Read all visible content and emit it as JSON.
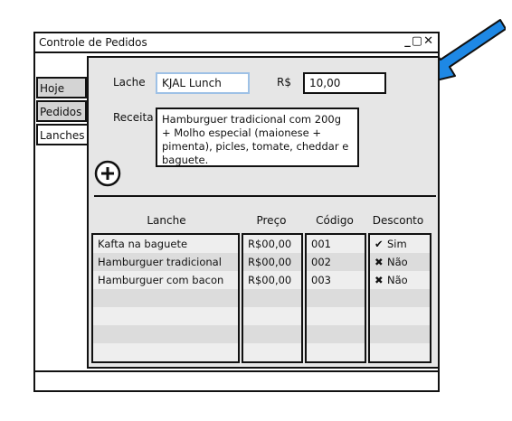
{
  "window": {
    "title": "Controle de Pedidos",
    "controls": [
      "_",
      "▢",
      "✕"
    ]
  },
  "tabs": [
    {
      "label": "Hoje",
      "active": false
    },
    {
      "label": "Pedidos",
      "active": false
    },
    {
      "label": "Lanches",
      "active": true
    }
  ],
  "form": {
    "lanche_label": "Lache",
    "lanche_value": "KJAL Lunch",
    "price_label": "R$",
    "price_value": "10,00",
    "receita_label": "Receita",
    "receita_value": "Hamburguer tradicional com 200g + Molho especial (maionese + pimenta), picles, tomate, cheddar e baguete."
  },
  "add_icon": "plus-circle-icon",
  "table": {
    "headers": {
      "lanche": "Lanche",
      "preco": "Preço",
      "codigo": "Código",
      "desconto": "Desconto"
    },
    "rows": [
      {
        "lanche": "Kafta na baguete",
        "preco": "R$00,00",
        "codigo": "001",
        "desconto": "Sim",
        "mark": "✔"
      },
      {
        "lanche": "Hamburguer tradicional",
        "preco": "R$00,00",
        "codigo": "002",
        "desconto": "Não",
        "mark": "✖"
      },
      {
        "lanche": "Hamburguer com bacon",
        "preco": "R$00,00",
        "codigo": "003",
        "desconto": "Não",
        "mark": "✖"
      }
    ],
    "empty_rows": 4
  },
  "colors": {
    "arrow": "#1e88e5",
    "panel": "#e6e6e6",
    "tab_inactive": "#d4d4d4",
    "focus_border": "#9ec1e6"
  }
}
